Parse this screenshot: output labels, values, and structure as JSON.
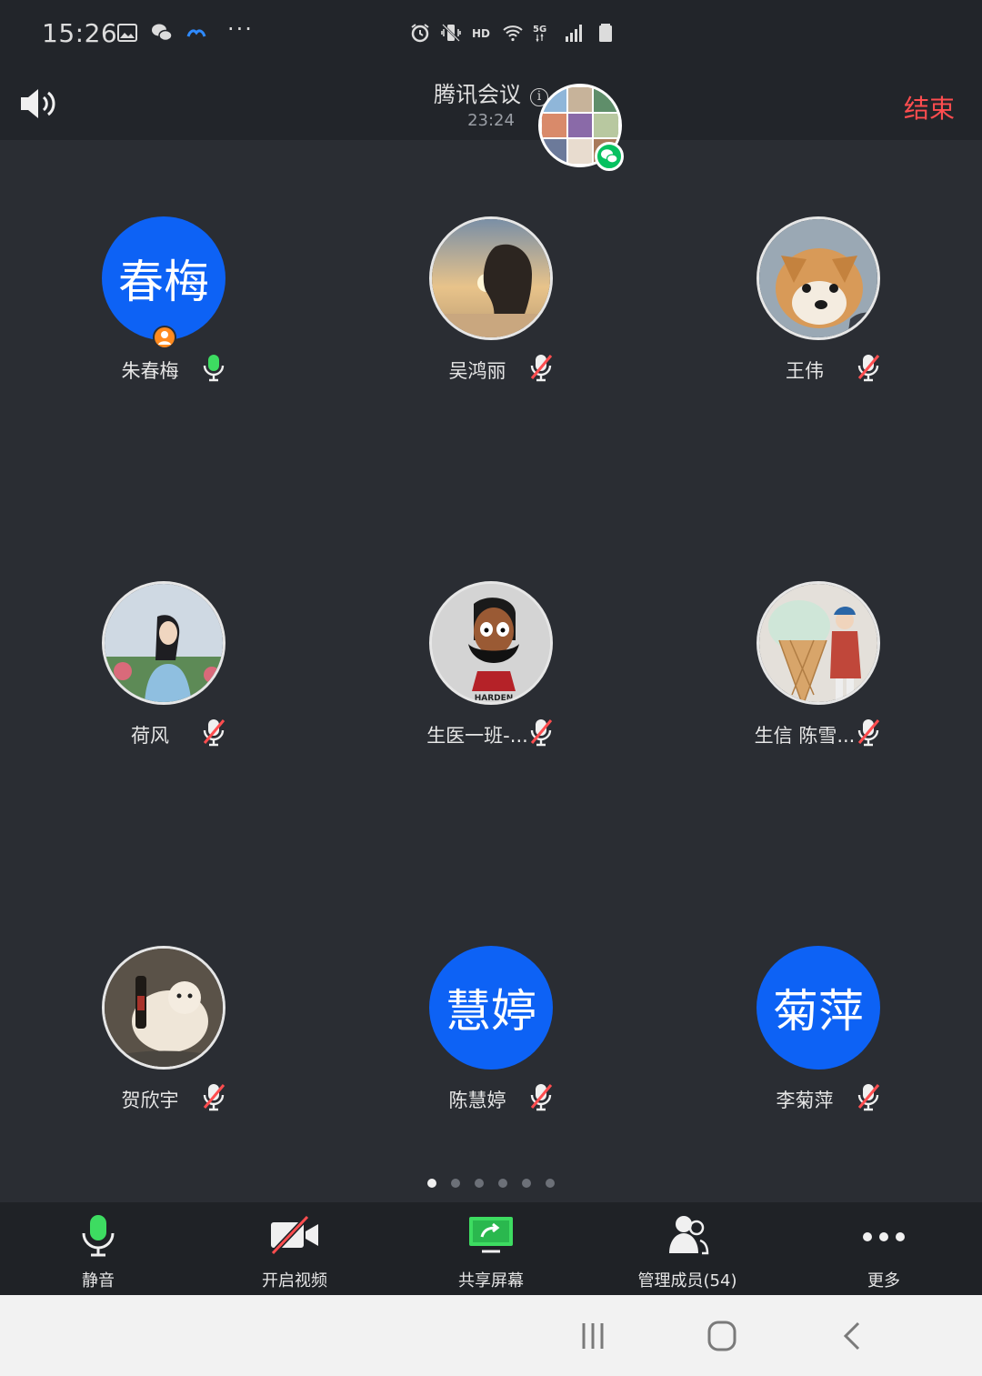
{
  "status_bar": {
    "time": "15:26",
    "left_icons": [
      "image-icon",
      "wechat-icon",
      "cloud-icon"
    ],
    "more": "···",
    "right_icons": [
      "alarm-icon",
      "vibrate-icon",
      "hd-icon",
      "wifi-icon",
      "5g-icon",
      "signal-icon",
      "battery-icon"
    ]
  },
  "header": {
    "title": "腾讯会议",
    "timer": "23:24",
    "end_label": "结束",
    "speaker_icon": "speaker-icon",
    "info_glyph": "i"
  },
  "participants": [
    {
      "name": "朱春梅",
      "avatar_text": "春梅",
      "mic": "on",
      "host": true
    },
    {
      "name": "吴鸿丽",
      "avatar_text": "",
      "mic": "muted"
    },
    {
      "name": "王伟",
      "avatar_text": "",
      "mic": "muted"
    },
    {
      "name": "荷风",
      "avatar_text": "",
      "mic": "muted"
    },
    {
      "name": "生医一班-...",
      "avatar_text": "",
      "mic": "muted",
      "avatar_caption": "HARDEN"
    },
    {
      "name": "生信 陈雪...",
      "avatar_text": "",
      "mic": "muted"
    },
    {
      "name": "贺欣宇",
      "avatar_text": "",
      "mic": "muted"
    },
    {
      "name": "陈慧婷",
      "avatar_text": "慧婷",
      "mic": "muted"
    },
    {
      "name": "李菊萍",
      "avatar_text": "菊萍",
      "mic": "muted"
    }
  ],
  "pager": {
    "pages": 6,
    "active": 0
  },
  "toolbar": {
    "mute": "静音",
    "video": "开启视频",
    "share": "共享屏幕",
    "members": "管理成员(54)",
    "more": "更多"
  },
  "colors": {
    "background": "#2a2d33",
    "accent_blue": "#0d62f5",
    "end_red": "#ff4d4f",
    "mic_green": "#3ddc61",
    "muted_red": "#ff4d4f"
  }
}
